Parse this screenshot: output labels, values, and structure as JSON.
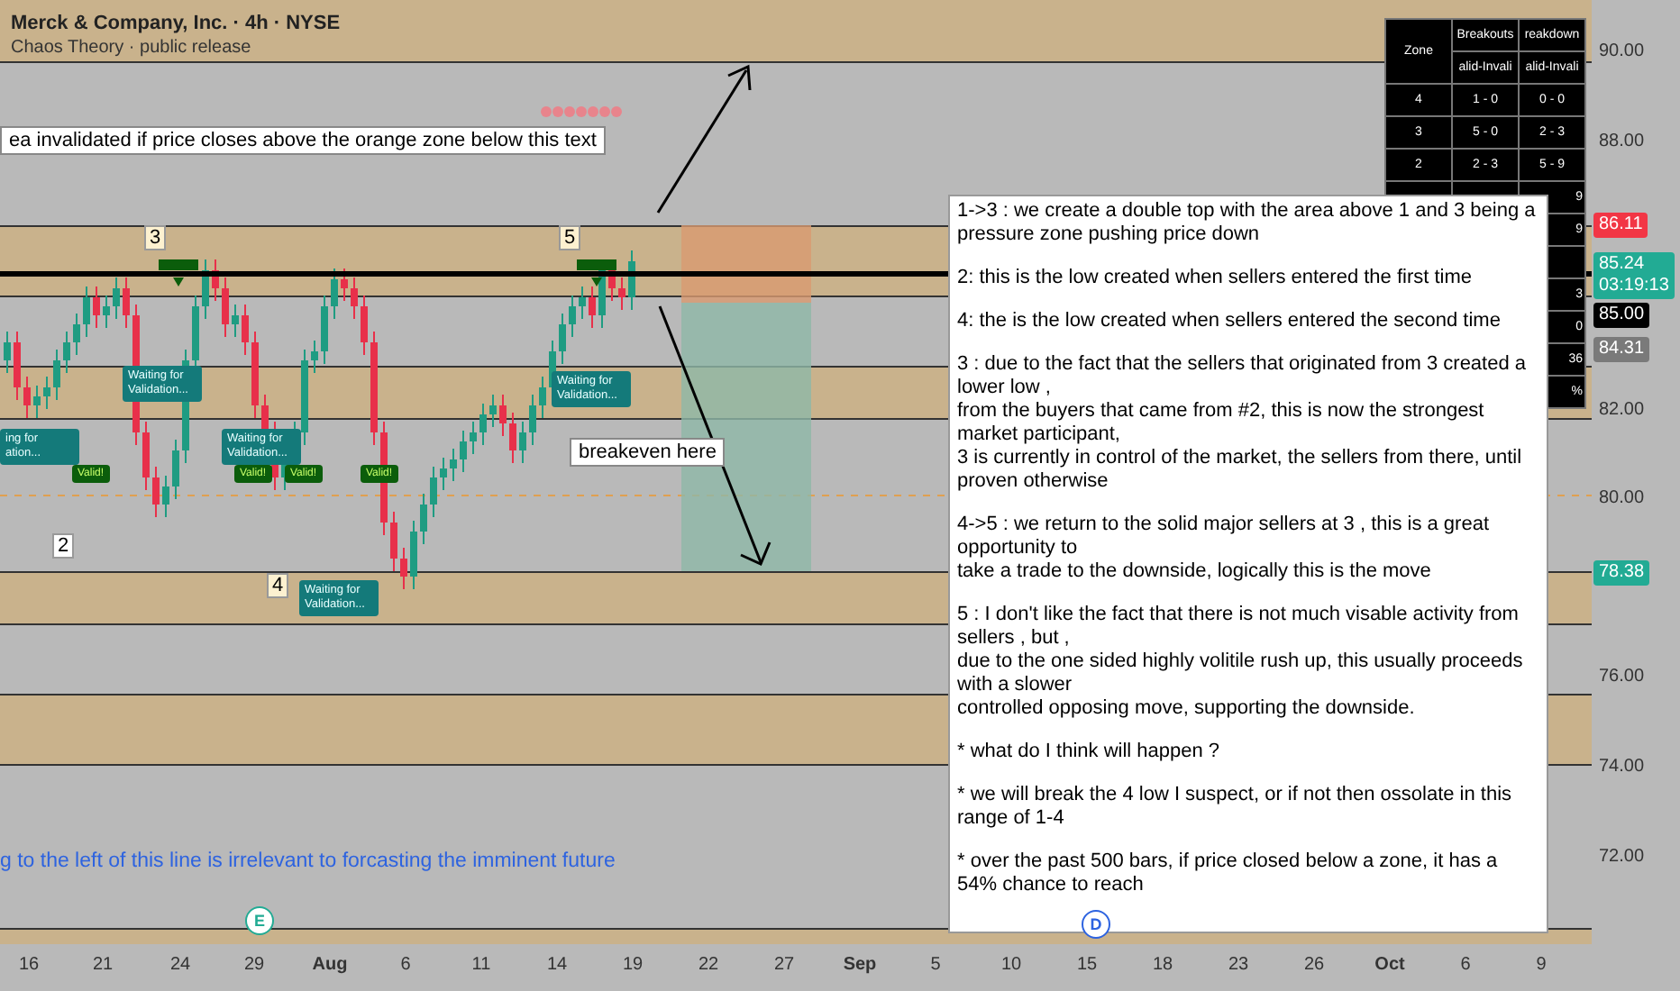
{
  "header": {
    "symbol": "Merck & Company, Inc. · 4h · NYSE",
    "indicator": "Chaos Theory · public release"
  },
  "invalidation_note": "ea invalidated if price closes above the orange zone below this text",
  "wave_labels": [
    "3",
    "5",
    "2",
    "4"
  ],
  "validation_tags": [
    "ing for ation...",
    "Waiting for Validation...",
    "Waiting for Validation...",
    "Waiting for Validation...",
    "Waiting for Validation..."
  ],
  "valid_tags": [
    "Valid!",
    "Valid!",
    "Valid!",
    "Valid!"
  ],
  "breakeven_note": "breakeven here",
  "line_caption": "g to the left of this line is irrelevant to forcasting the imminent future",
  "earnings_badge": "E",
  "dividend_badge": "D",
  "stats_table": {
    "zone_header": "Zone",
    "headers": [
      "Breakouts",
      "reakdown"
    ],
    "subheaders": [
      "alid-Invali",
      "alid-Invali"
    ],
    "rows": [
      {
        "zone": "4",
        "breakouts": "1 - 0",
        "breakdowns": "0 - 0"
      },
      {
        "zone": "3",
        "breakouts": "5 - 0",
        "breakdowns": "2 - 3"
      },
      {
        "zone": "2",
        "breakouts": "2 - 3",
        "breakdowns": "5 - 9"
      },
      {
        "breakdowns": "9"
      },
      {
        "breakdowns": "9"
      },
      {
        "breakdowns": ""
      },
      {
        "breakdowns": "3"
      },
      {
        "breakdowns": "0"
      },
      {
        "breakdowns": "36"
      },
      {
        "breakdowns": "%"
      }
    ]
  },
  "analysis_note": {
    "paragraphs": [
      "1->3  : we create a double top with the area above 1 and 3 being a pressure zone pushing price down",
      "2: this is the low created when sellers entered the first time",
      "4: the is the low created when sellers entered the second time",
      "3 : due to the fact that the sellers that originated from 3 created a lower low ,\nfrom the buyers that came from #2, this is now the strongest market participant,\n3 is currently in control of the market, the sellers from there, until proven otherwise",
      "4->5 : we return to the solid major sellers at 3 , this is a great opportunity to\ntake a trade to the downside, logically this is the move",
      "5 : I don't like the fact that there is not much visable activity from sellers , but ,\ndue to the one sided highly volitile rush up, this usually proceeds with a slower\ncontrolled opposing move, supporting the downside.",
      "* what do I think will happen ?",
      "* we will break the 4 low I suspect, or if not then ossolate in this range of 1-4",
      "* over the past 500 bars, if price closed below a zone, it has a 54% chance to reach"
    ]
  },
  "price_axis": [
    {
      "label": "90.00",
      "kind": "tick"
    },
    {
      "label": "88.00",
      "kind": "tick"
    },
    {
      "label": "86.11",
      "kind": "tag",
      "color": "#f23645"
    },
    {
      "label": "85.24\n03:19:13",
      "kind": "tag",
      "color": "#22ab94"
    },
    {
      "label": "85.00",
      "kind": "tag",
      "color": "#000000"
    },
    {
      "label": "84.31",
      "kind": "tag",
      "color": "#7a7a7a"
    },
    {
      "label": "82.00",
      "kind": "tick"
    },
    {
      "label": "80.00",
      "kind": "tick"
    },
    {
      "label": "78.38",
      "kind": "tag",
      "color": "#22ab94"
    },
    {
      "label": "76.00",
      "kind": "tick"
    },
    {
      "label": "74.00",
      "kind": "tick"
    },
    {
      "label": "72.00",
      "kind": "tick"
    }
  ],
  "time_axis": [
    {
      "label": "16",
      "kind": "day"
    },
    {
      "label": "21",
      "kind": "day"
    },
    {
      "label": "24",
      "kind": "day"
    },
    {
      "label": "29",
      "kind": "day"
    },
    {
      "label": "Aug",
      "kind": "month"
    },
    {
      "label": "6",
      "kind": "day"
    },
    {
      "label": "11",
      "kind": "day"
    },
    {
      "label": "14",
      "kind": "day"
    },
    {
      "label": "19",
      "kind": "day"
    },
    {
      "label": "22",
      "kind": "day"
    },
    {
      "label": "27",
      "kind": "day"
    },
    {
      "label": "Sep",
      "kind": "month"
    },
    {
      "label": "5",
      "kind": "day"
    },
    {
      "label": "10",
      "kind": "day"
    },
    {
      "label": "15",
      "kind": "day"
    },
    {
      "label": "18",
      "kind": "day"
    },
    {
      "label": "23",
      "kind": "day"
    },
    {
      "label": "26",
      "kind": "day"
    },
    {
      "label": "Oct",
      "kind": "month"
    },
    {
      "label": "6",
      "kind": "day"
    },
    {
      "label": "9",
      "kind": "day"
    }
  ]
}
